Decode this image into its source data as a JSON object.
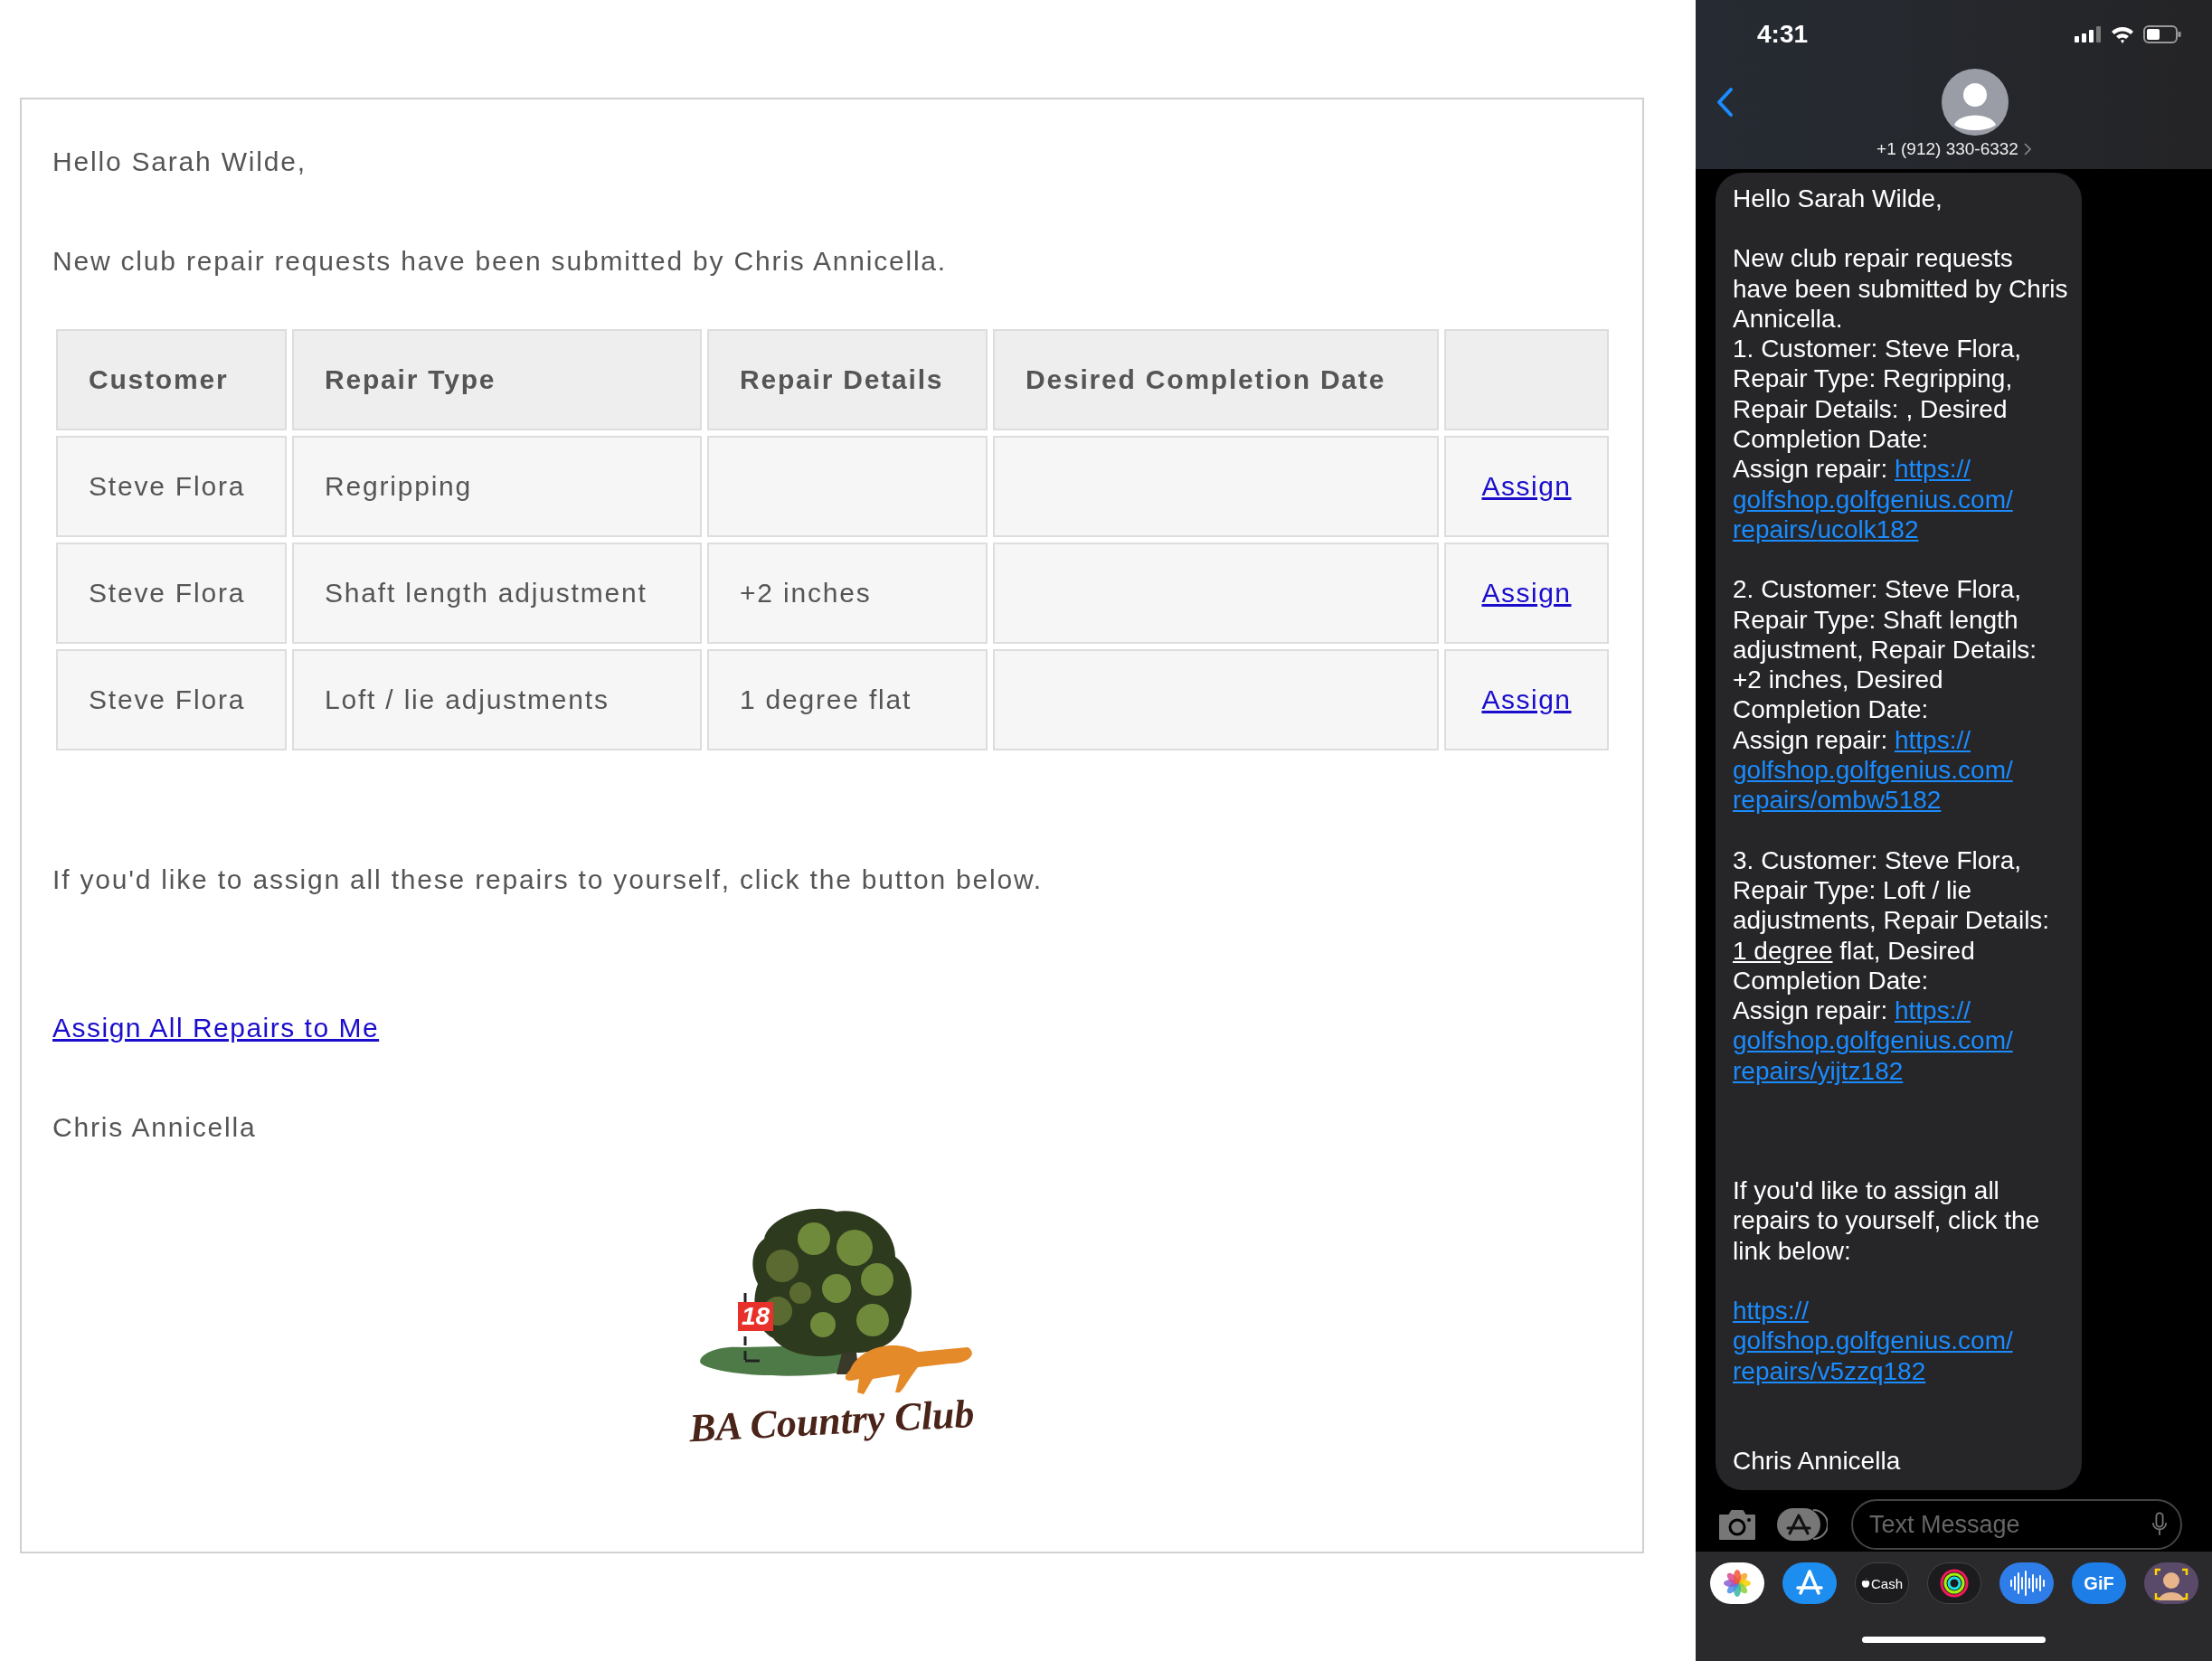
{
  "email": {
    "greeting": "Hello Sarah Wilde,",
    "intro": "New club repair requests have been submitted by Chris Annicella.",
    "table": {
      "columns": [
        "Customer",
        "Repair Type",
        "Repair Details",
        "Desired Completion Date"
      ],
      "rows": [
        {
          "customer": "Steve Flora",
          "repair_type": "Regripping",
          "action": "Assign"
        },
        {
          "customer": "Steve Flora",
          "repair_type": "Shaft length adjustment",
          "repair_details": "+2 inches",
          "action": "Assign"
        },
        {
          "customer": "Steve Flora",
          "repair_type": "Loft / lie adjustments",
          "repair_details": "1 degree flat",
          "action": "Assign"
        }
      ]
    },
    "assign_all_note": "If you'd like to assign all these repairs to yourself, click the button below.",
    "assign_all_link": "Assign All Repairs to Me",
    "signature": "Chris Annicella",
    "logo": {
      "flag_number": "18",
      "name": "BA Country Club"
    }
  },
  "phone": {
    "status_bar": {
      "time": "4:31"
    },
    "contact": {
      "phone": "+1 (912) 330-6332"
    },
    "message": {
      "paragraphs": [
        {
          "kind": "greeting",
          "lines": [
            [
              {
                "kind": "text",
                "text": "Hello Sarah Wilde,"
              }
            ]
          ]
        },
        {
          "kind": "body",
          "lines": [
            [
              {
                "kind": "text",
                "text": "New club repair requests have been submitted by Chris Annicella."
              }
            ],
            [
              {
                "kind": "text",
                "text": "1. Customer: Steve Flora, Repair Type: Regripping, Repair Details: , Desired Completion Date:"
              }
            ],
            [
              {
                "kind": "text",
                "text": "Assign repair: "
              },
              {
                "kind": "link",
                "text": "https://golfshop.golfgenius.com/repairs/ucolk182"
              }
            ]
          ]
        },
        {
          "kind": "body",
          "lines": [
            [
              {
                "kind": "text",
                "text": "2. Customer: Steve Flora, Repair Type: Shaft length adjustment, Repair Details: +2 inches, Desired Completion Date:"
              }
            ],
            [
              {
                "kind": "text",
                "text": "Assign repair: "
              },
              {
                "kind": "link",
                "text": "https://golfshop.golfgenius.com/repairs/ombw5182"
              }
            ]
          ]
        },
        {
          "kind": "body",
          "lines": [
            [
              {
                "kind": "text",
                "text": "3. Customer: Steve Flora, Repair Type: Loft / lie adjustments, Repair Details: "
              },
              {
                "kind": "detected",
                "text": "1 degree"
              },
              {
                "kind": "text",
                "text": " flat, Desired Completion Date:"
              }
            ],
            [
              {
                "kind": "text",
                "text": "Assign repair: "
              },
              {
                "kind": "link",
                "text": "https://golfshop.golfgenius.com/repairs/yijtz182"
              }
            ]
          ]
        },
        {
          "kind": "footer",
          "lines": [
            [
              {
                "kind": "text",
                "text": "If you'd like to assign all repairs to yourself, click the link below:"
              }
            ]
          ]
        },
        {
          "kind": "body",
          "lines": [
            [
              {
                "kind": "link",
                "text": "https://golfshop.golfgenius.com/repairs/v5zzq182"
              }
            ]
          ]
        },
        {
          "kind": "signature",
          "lines": [
            [
              {
                "kind": "text",
                "text": "Chris Annicella"
              }
            ]
          ]
        }
      ]
    },
    "composer": {
      "placeholder": "Text Message"
    },
    "app_drawer": [
      {
        "kind": "photos"
      },
      {
        "kind": "appstore"
      },
      {
        "kind": "cash",
        "label": "Cash"
      },
      {
        "kind": "fitness"
      },
      {
        "kind": "audio"
      },
      {
        "kind": "gif",
        "label": "GiF"
      },
      {
        "kind": "memoji"
      }
    ]
  }
}
